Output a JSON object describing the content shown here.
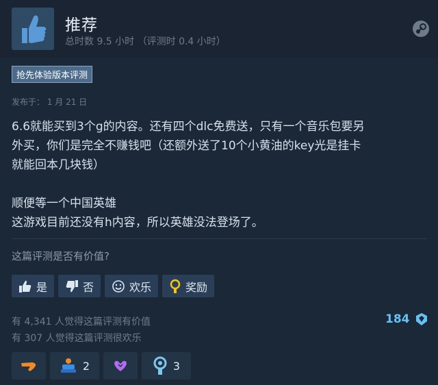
{
  "review": {
    "verdict": "推荐",
    "hours": "总时数 9.5 小时 （评测时 0.4 小时）",
    "early_access_tag": "抢先体验版本评测",
    "posted": "发布于：  1 月 21 日",
    "body_lines": [
      "6.6就能买到3个g的内容。还有四个dlc免费送，只有一个音乐包要另",
      "外买，你们是完全不赚钱吧（还额外送了10个小黄油的key光是挂卡",
      "就能回本几块钱）",
      "",
      "顺便等一个中国英雄",
      "这游戏目前还没有h内容，所以英雄没法登场了。"
    ]
  },
  "feedback": {
    "question": "这篇评测是否有价值?",
    "yes": "是",
    "no": "否",
    "funny": "欢乐",
    "award": "奖励"
  },
  "stats": {
    "helpful": "有 4,341 人觉得这篇评测有价值",
    "funny": "有 307 人觉得这篇评测很欢乐",
    "award_total": "184"
  },
  "awards": [
    {
      "icon": "orange-hand-award-icon",
      "count": ""
    },
    {
      "icon": "blue-trophy-award-icon",
      "count": "2"
    },
    {
      "icon": "purple-heart-award-icon",
      "count": ""
    },
    {
      "icon": "blue-medal-award-icon",
      "count": "3"
    }
  ],
  "colors": {
    "background": "#1b2838",
    "header": "#1a2433",
    "accent": "#66c0f4",
    "button": "#2a3f57"
  }
}
